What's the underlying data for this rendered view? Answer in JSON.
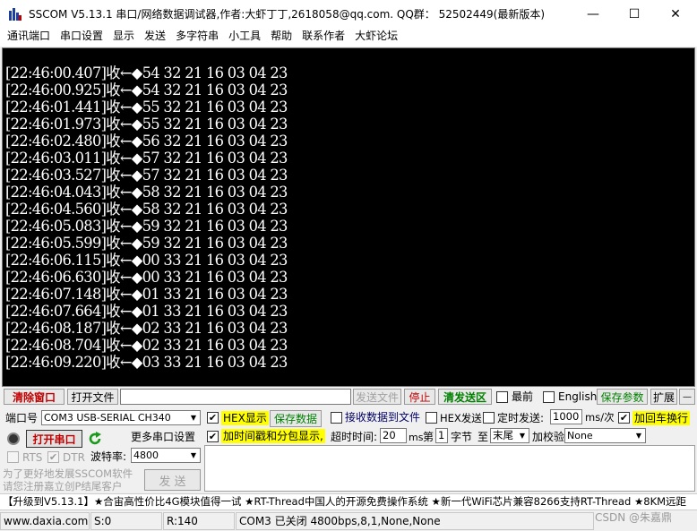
{
  "window": {
    "title": "SSCOM V5.13.1 串口/网络数据调试器,作者:大虾丁丁,2618058@qq.com. QQ群：  52502449(最新版本)",
    "minimize": "—",
    "maximize": "☐",
    "close": "✕"
  },
  "menu": [
    "通讯端口",
    "串口设置",
    "显示",
    "发送",
    "多字符串",
    "小工具",
    "帮助",
    "联系作者",
    "大虾论坛"
  ],
  "terminal": {
    "lines": [
      "[22:46:00.407]收←◆54 32 21 16 03 04 23",
      "[22:46:00.925]收←◆54 32 21 16 03 04 23",
      "[22:46:01.441]收←◆55 32 21 16 03 04 23",
      "[22:46:01.973]收←◆55 32 21 16 03 04 23",
      "[22:46:02.480]收←◆56 32 21 16 03 04 23",
      "[22:46:03.011]收←◆57 32 21 16 03 04 23",
      "[22:46:03.527]收←◆57 32 21 16 03 04 23",
      "[22:46:04.043]收←◆58 32 21 16 03 04 23",
      "[22:46:04.560]收←◆58 32 21 16 03 04 23",
      "[22:46:05.083]收←◆59 32 21 16 03 04 23",
      "[22:46:05.599]收←◆59 32 21 16 03 04 23",
      "[22:46:06.115]收←◆00 33 21 16 03 04 23",
      "[22:46:06.630]收←◆00 33 21 16 03 04 23",
      "[22:46:07.148]收←◆01 33 21 16 03 04 23",
      "[22:46:07.664]收←◆01 33 21 16 03 04 23",
      "[22:46:08.187]收←◆02 33 21 16 03 04 23",
      "[22:46:08.704]收←◆02 33 21 16 03 04 23",
      "[22:46:09.220]收←◆03 33 21 16 03 04 23"
    ]
  },
  "toolbar": {
    "clear_window": "清除窗口",
    "open_file": "打开文件",
    "send_file": "发送文件",
    "stop": "停止",
    "clear_send": "清发送区",
    "topmost": "最前",
    "english": "English",
    "save_params": "保存参数",
    "expand": "扩展",
    "dash": "—"
  },
  "port": {
    "port_label": "端口号",
    "port_value": "COM3 USB-SERIAL CH340",
    "open_port": "打开串口",
    "more_settings": "更多串口设置",
    "rts": "RTS",
    "dtr": "DTR",
    "baud_label": "波特率:",
    "baud_value": "4800",
    "promo_line1": "为了更好地发展SSCOM软件",
    "promo_line2": "请您注册嘉立创P结尾客户"
  },
  "options": {
    "hex_display": "HEX显示",
    "save_data": "保存数据",
    "recv_to_file": "接收数据到文件",
    "hex_send": "HEX发送",
    "timed_send": "定时发送:",
    "timed_value": "1000",
    "timed_unit": "ms/次",
    "add_crlf": "加回车换行",
    "add_timestamp": "加时间戳和分包显示,",
    "timeout_label": "超时时间:",
    "timeout_value": "20",
    "timeout_unit": "ms",
    "nth_label": "第",
    "nth_value": "1",
    "byte_label": "字节",
    "to_label": "至",
    "to_value": "末尾",
    "checksum_label": "加校验",
    "checksum_value": "None",
    "send_button": "发  送"
  },
  "ticker": "【升级到V5.13.1】★合宙高性价比4G模块值得一试 ★RT-Thread中国人的开源免费操作系统 ★新一代WiFi芯片兼容8266支持RT-Thread ★8KM远距",
  "statusbar": {
    "website": "www.daxia.com",
    "sent": "S:0",
    "received": "R:140",
    "port_status": "COM3 已关闭  4800bps,8,1,None,None",
    "watermark": "CSDN @朱嘉鼎"
  },
  "colors": {
    "terminal_bg": "#000000",
    "terminal_fg": "#ffffff",
    "highlight": "#ffff00",
    "accent_red": "#c00000",
    "accent_green": "#008000"
  }
}
